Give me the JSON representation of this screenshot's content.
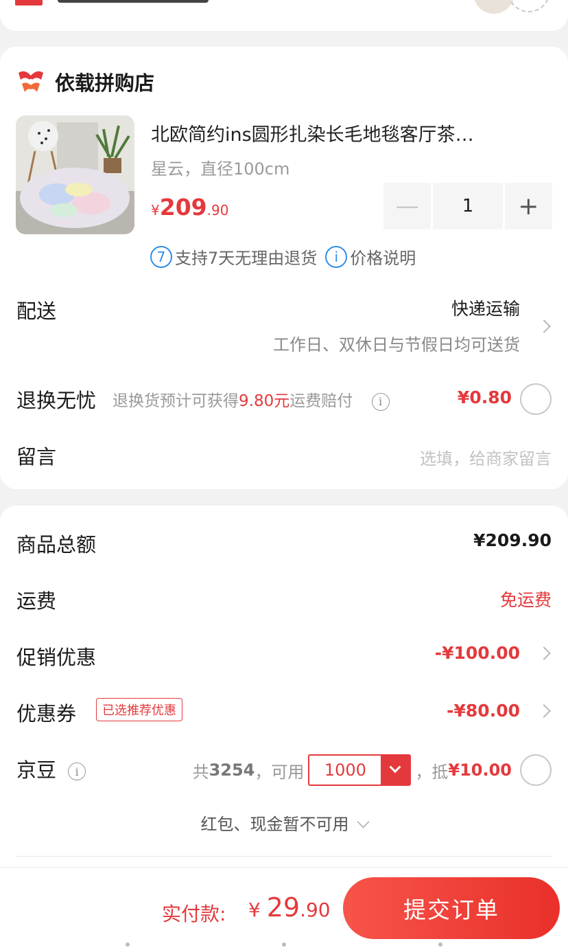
{
  "shop": {
    "name": "依载拼购店"
  },
  "product": {
    "title": "北欧简约ins圆形扎染长毛地毯客厅茶…",
    "spec": "星云，直径100cm",
    "price_yen": "¥",
    "price_int": "209",
    "price_dec": ".90",
    "quantity": "1",
    "minus": "—",
    "plus": "+"
  },
  "policies": {
    "return_icon": "7",
    "return_text": "支持7天无理由退货",
    "price_icon": "i",
    "price_text": "价格说明"
  },
  "delivery": {
    "label": "配送",
    "method": "快递运输",
    "note": "工作日、双休日与节假日均可送货"
  },
  "return_insurance": {
    "label": "退换无忧",
    "desc_pre": "退换货预计可获得",
    "desc_amount": "9.80元",
    "desc_post": "运费赔付",
    "price": "¥0.80",
    "selected": false
  },
  "message": {
    "label": "留言",
    "placeholder": "选填，给商家留言"
  },
  "summary": {
    "goods_total_label": "商品总额",
    "goods_total": "¥209.90",
    "shipping_label": "运费",
    "shipping": "免运费",
    "promo_label": "促销优惠",
    "promo": "-¥100.00",
    "coupon_label": "优惠券",
    "coupon_tag": "已选推荐优惠",
    "coupon": "-¥80.00",
    "beans_label": "京豆",
    "beans_total_pre": "共",
    "beans_total": "3254",
    "beans_avail": "，可用",
    "beans_selected": "1000",
    "beans_deduct_pre": "，抵",
    "beans_deduct": "¥10.00",
    "redpack_text": "红包、现金暂不可用"
  },
  "bottom": {
    "pay_label": "实付款:",
    "pay_yen": "¥ ",
    "pay_int": "29",
    "pay_dec": ".90",
    "submit": "提交订单"
  },
  "colors": {
    "accent": "#e4393c",
    "info_blue": "#2f8ee8"
  }
}
